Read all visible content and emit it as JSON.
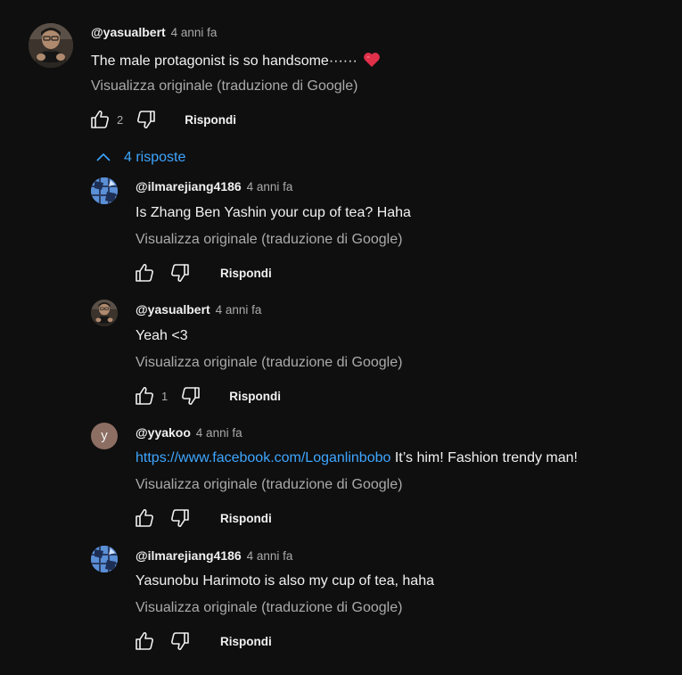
{
  "main_comment": {
    "author": "@yasualbert",
    "time": "4 anni fa",
    "text": "The male protagonist is so handsome······",
    "heart_emoji": "❤️",
    "translate_label": "Visualizza originale (traduzione di Google)",
    "likes": "2",
    "reply_label": "Rispondi"
  },
  "replies_toggle": {
    "label": "4 risposte"
  },
  "replies": [
    {
      "author": "@ilmarejiang4186",
      "time": "4 anni fa",
      "text": "Is Zhang Ben Yashin your cup of tea? Haha",
      "translate_label": "Visualizza originale (traduzione di Google)",
      "reply_label": "Rispondi"
    },
    {
      "author": "@yasualbert",
      "time": "4 anni fa",
      "text": "Yeah <3",
      "translate_label": "Visualizza originale (traduzione di Google)",
      "likes": "1",
      "reply_label": "Rispondi"
    },
    {
      "author": "@yyakoo",
      "avatar_letter": "y",
      "time": "4 anni fa",
      "link": "https://www.facebook.com/Loganlinbobo",
      "text": " It’s him! Fashion trendy man!",
      "translate_label": "Visualizza originale (traduzione di Google)",
      "reply_label": "Rispondi"
    },
    {
      "author": "@ilmarejiang4186",
      "time": "4 anni fa",
      "text": "Yasunobu Harimoto is also my cup of tea, haha",
      "translate_label": "Visualizza originale (traduzione di Google)",
      "reply_label": "Rispondi"
    }
  ],
  "colors": {
    "background": "#0f0f0f",
    "link": "#3ea6ff",
    "secondary_text": "#aaaaaa",
    "heart": "#e0304a",
    "yyakoo_avatar": "#8d6e63"
  },
  "icons": [
    "thumb-up-icon",
    "thumb-down-icon",
    "chevron-up-icon",
    "heart-emoji"
  ]
}
